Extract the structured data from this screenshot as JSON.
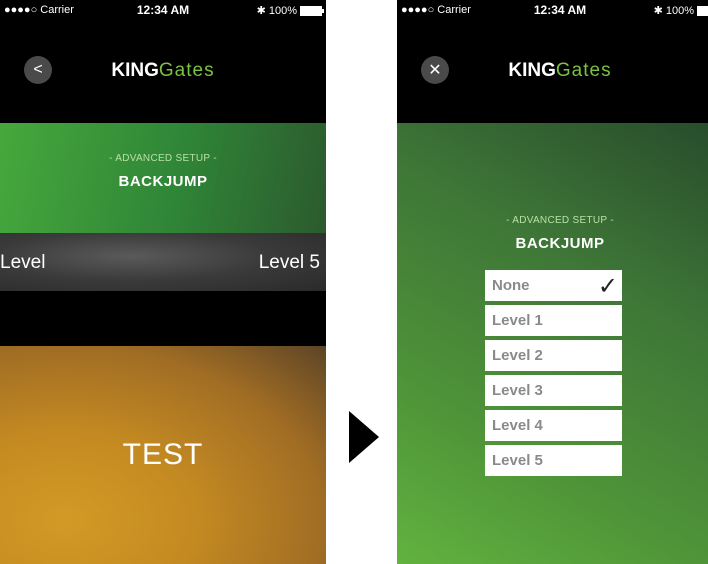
{
  "status_bar": {
    "signal": "●●●●○ Carrier",
    "time": "12:34 AM",
    "battery": "100%"
  },
  "logo": {
    "king": "KING",
    "gates": "Gates"
  },
  "left_screen": {
    "back_icon": "chevron-left-icon",
    "section_label": "- ADVANCED SETUP -",
    "title": "BACKJUMP",
    "setting_label": "Level",
    "setting_value": "Level 5",
    "test_button": "TEST"
  },
  "right_screen": {
    "close_icon": "close-icon",
    "section_label": "- ADVANCED SETUP -",
    "title": "BACKJUMP",
    "options": [
      "None",
      "Level 1",
      "Level 2",
      "Level 3",
      "Level 4",
      "Level 5"
    ],
    "selected": "None"
  },
  "colors": {
    "brand_green": "#7cc242",
    "header_green": "#46a83c",
    "test_orange": "#d29a25"
  }
}
